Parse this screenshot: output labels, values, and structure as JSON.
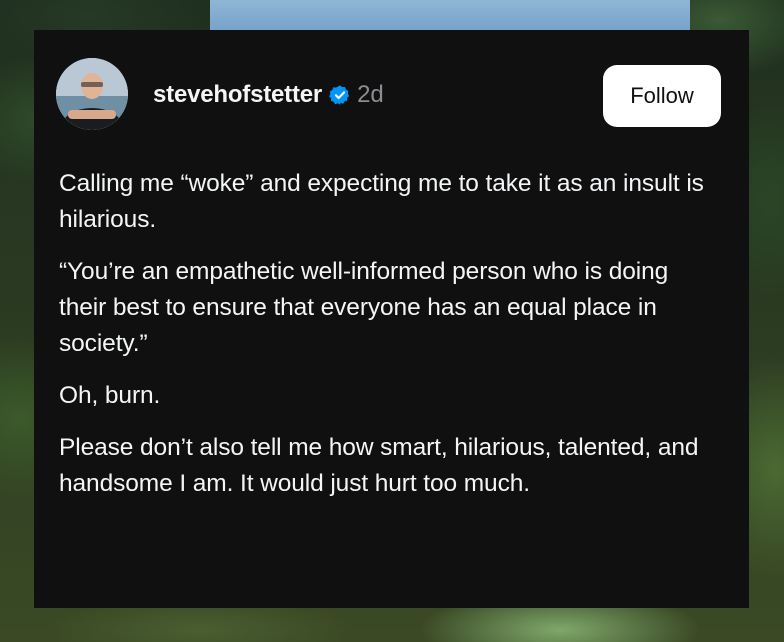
{
  "post": {
    "username": "stevehofstetter",
    "time_ago": "2d",
    "follow_label": "Follow",
    "paragraphs": [
      "Calling me “woke” and expecting me to take it as an insult is hilarious.",
      "“You’re an empathetic well-informed person who is doing their best to ensure that everyone has an equal place in society.”",
      "Oh, burn.",
      "Please don’t also tell me how smart, hilarious, talented, and handsome I am. It would just hurt too much."
    ]
  },
  "icons": {
    "verified": "verified-badge-icon",
    "verified_color": "#0095f6"
  },
  "colors": {
    "card_background": "#101010",
    "text_primary": "#f3f5f7",
    "text_secondary": "#8a8d91",
    "button_background": "#ffffff"
  }
}
